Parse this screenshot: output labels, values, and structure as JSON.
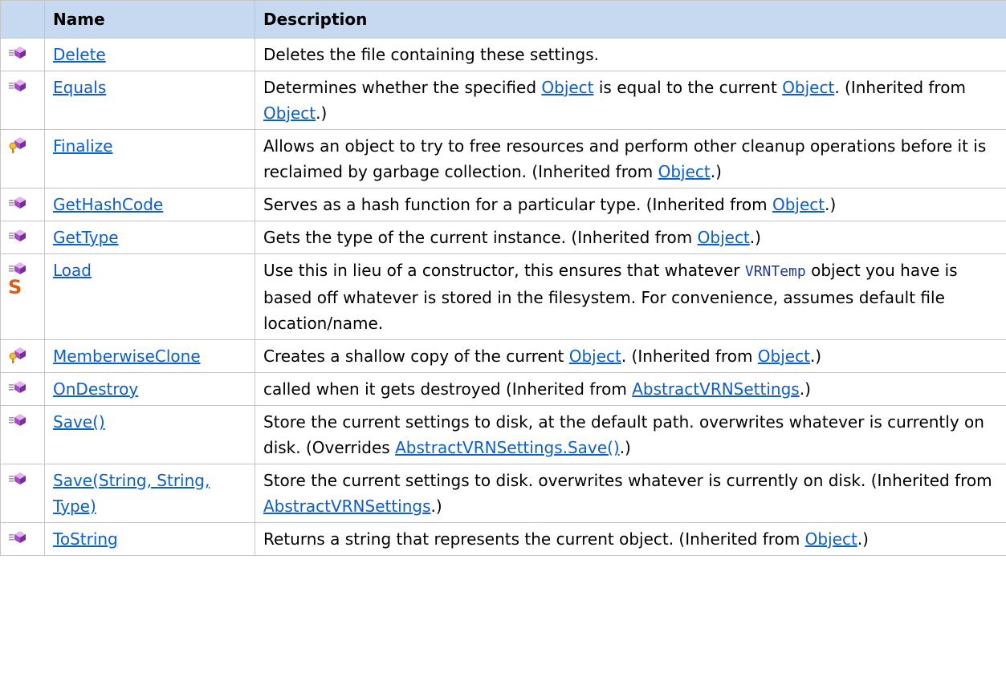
{
  "header": {
    "name": "Name",
    "description": "Description"
  },
  "rows": [
    {
      "icon": "public-method-icon",
      "name": "Delete",
      "desc": [
        {
          "t": "Deletes the file containing these settings."
        }
      ]
    },
    {
      "icon": "public-method-icon",
      "name": "Equals",
      "desc": [
        {
          "t": "Determines whether the specified "
        },
        {
          "link": "Object"
        },
        {
          "t": " is equal to the current "
        },
        {
          "link": "Object"
        },
        {
          "t": ". (Inherited from "
        },
        {
          "link": "Object"
        },
        {
          "t": ".)"
        }
      ]
    },
    {
      "icon": "protected-method-icon",
      "name": "Finalize",
      "desc": [
        {
          "t": "Allows an object to try to free resources and perform other cleanup operations before it is reclaimed by garbage collection. (Inherited from "
        },
        {
          "link": "Object"
        },
        {
          "t": ".)"
        }
      ]
    },
    {
      "icon": "public-method-icon",
      "name": "GetHashCode",
      "desc": [
        {
          "t": "Serves as a hash function for a particular type. (Inherited from "
        },
        {
          "link": "Object"
        },
        {
          "t": ".)"
        }
      ]
    },
    {
      "icon": "public-method-icon",
      "name": "GetType",
      "desc": [
        {
          "t": "Gets the type of the current instance. (Inherited from "
        },
        {
          "link": "Object"
        },
        {
          "t": ".)"
        }
      ]
    },
    {
      "icon": "public-method-icon",
      "static": "S",
      "name": "Load",
      "desc": [
        {
          "t": "Use this in lieu of a constructor, this ensures that whatever "
        },
        {
          "code": "VRNTemp"
        },
        {
          "t": " object you have is based off whatever is stored in the filesystem. For convenience, assumes default file location/name."
        }
      ]
    },
    {
      "icon": "protected-method-icon",
      "name": "MemberwiseClone",
      "desc": [
        {
          "t": "Creates a shallow copy of the current "
        },
        {
          "link": "Object"
        },
        {
          "t": ". (Inherited from "
        },
        {
          "link": "Object"
        },
        {
          "t": ".)"
        }
      ]
    },
    {
      "icon": "public-method-icon",
      "name": "OnDestroy",
      "desc": [
        {
          "t": "called when it gets destroyed (Inherited from "
        },
        {
          "link": "AbstractVRNSettings"
        },
        {
          "t": ".)"
        }
      ]
    },
    {
      "icon": "public-method-icon",
      "name": "Save()",
      "desc": [
        {
          "t": "Store the current settings to disk, at the default path. overwrites whatever is currently on disk. (Overrides "
        },
        {
          "link": "AbstractVRNSettings.Save()"
        },
        {
          "t": ".)"
        }
      ]
    },
    {
      "icon": "public-method-icon",
      "name": "Save(String, String, Type)",
      "desc": [
        {
          "t": "Store the current settings to disk. overwrites whatever is currently on disk. (Inherited from "
        },
        {
          "link": "AbstractVRNSettings"
        },
        {
          "t": ".)"
        }
      ]
    },
    {
      "icon": "public-method-icon",
      "name": "ToString",
      "desc": [
        {
          "t": "Returns a string that represents the current object. (Inherited from "
        },
        {
          "link": "Object"
        },
        {
          "t": ".)"
        }
      ]
    }
  ],
  "colors": {
    "header_bg": "#c6d9f1",
    "link": "#0c5ec9",
    "static_icon": "#e05a12",
    "grid": "#c4c4c4"
  }
}
